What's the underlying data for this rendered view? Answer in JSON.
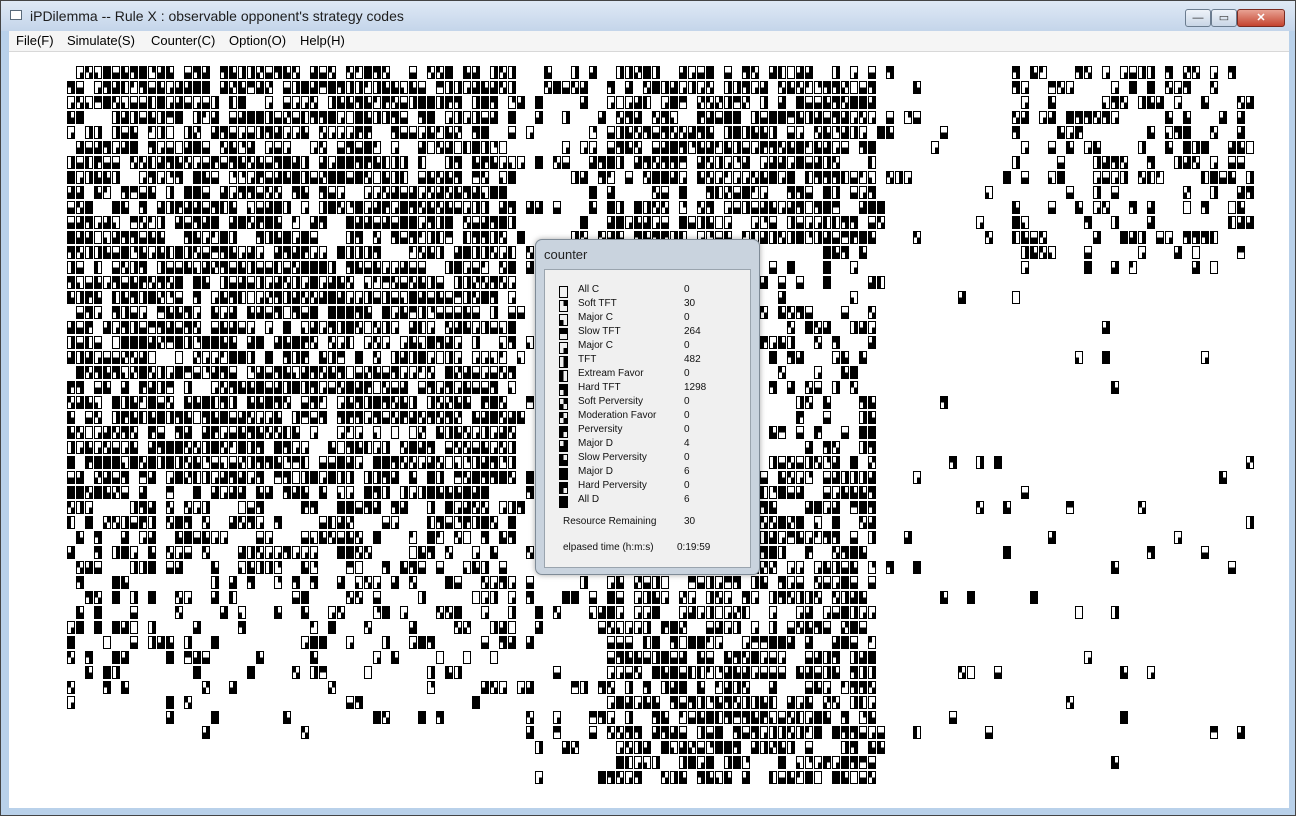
{
  "window": {
    "title": "iPDilemma -- Rule X : observable opponent's strategy codes",
    "minimize_label": "—",
    "maximize_label": "▭",
    "close_label": "✕"
  },
  "menu": [
    "File(F)",
    "Simulate(S)",
    "Counter(C)",
    "Option(O)",
    "Help(H)"
  ],
  "counter": {
    "title": "counter",
    "strategies": [
      {
        "name": "All C",
        "count": "0",
        "code": "0000"
      },
      {
        "name": "Soft TFT",
        "count": "30",
        "code": "0100"
      },
      {
        "name": "Major C",
        "count": "0",
        "code": "0010"
      },
      {
        "name": "Slow TFT",
        "count": "264",
        "code": "1100"
      },
      {
        "name": "Major C",
        "count": "0",
        "code": "0001"
      },
      {
        "name": "TFT",
        "count": "482",
        "code": "0101"
      },
      {
        "name": "Extream Favor",
        "count": "0",
        "code": "1010"
      },
      {
        "name": "Hard TFT",
        "count": "1298",
        "code": "1101"
      },
      {
        "name": "Soft Perversity",
        "count": "0",
        "code": "0110"
      },
      {
        "name": "Moderation Favor",
        "count": "0",
        "code": "1001"
      },
      {
        "name": "Perversity",
        "count": "0",
        "code": "1110"
      },
      {
        "name": "Major D",
        "count": "4",
        "code": "0111"
      },
      {
        "name": "Slow Perversity",
        "count": "0",
        "code": "1011"
      },
      {
        "name": "Major D",
        "count": "6",
        "code": "1111"
      },
      {
        "name": "Hard Perversity",
        "count": "0",
        "code": "1110"
      },
      {
        "name": "All D",
        "count": "6",
        "code": "1111"
      }
    ],
    "resource_label": "Resource Remaining",
    "resource_value": "30",
    "elapsed_label": "elpased time (h:m:s)",
    "elapsed_value": "0:19:59"
  }
}
